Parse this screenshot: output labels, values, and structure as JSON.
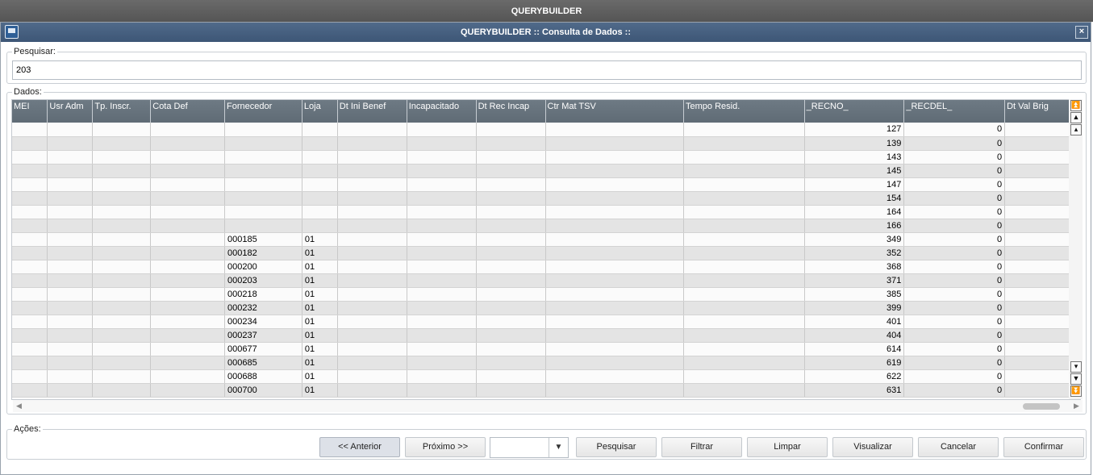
{
  "window": {
    "title": "QUERYBUILDER",
    "dialog_title": "QUERYBUILDER :: Consulta de Dados ::",
    "close_label": "×"
  },
  "search": {
    "legend": "Pesquisar:",
    "value": "203"
  },
  "data_group": {
    "legend": "Dados:",
    "columns": [
      "MEI",
      "Usr Adm",
      "Tp. Inscr.",
      "Cota Def",
      "Fornecedor",
      "Loja",
      "Dt Ini Benef",
      "Incapacitado",
      "Dt Rec Incap",
      "Ctr Mat TSV",
      "Tempo Resid.",
      "_RECNO_",
      "_RECDEL_",
      "Dt Val Brig"
    ],
    "rows": [
      {
        "fornecedor": "",
        "loja": "",
        "recno": "127",
        "recdel": "0"
      },
      {
        "fornecedor": "",
        "loja": "",
        "recno": "139",
        "recdel": "0"
      },
      {
        "fornecedor": "",
        "loja": "",
        "recno": "143",
        "recdel": "0"
      },
      {
        "fornecedor": "",
        "loja": "",
        "recno": "145",
        "recdel": "0"
      },
      {
        "fornecedor": "",
        "loja": "",
        "recno": "147",
        "recdel": "0"
      },
      {
        "fornecedor": "",
        "loja": "",
        "recno": "154",
        "recdel": "0"
      },
      {
        "fornecedor": "",
        "loja": "",
        "recno": "164",
        "recdel": "0"
      },
      {
        "fornecedor": "",
        "loja": "",
        "recno": "166",
        "recdel": "0"
      },
      {
        "fornecedor": "000185",
        "loja": "01",
        "recno": "349",
        "recdel": "0"
      },
      {
        "fornecedor": "000182",
        "loja": "01",
        "recno": "352",
        "recdel": "0"
      },
      {
        "fornecedor": "000200",
        "loja": "01",
        "recno": "368",
        "recdel": "0"
      },
      {
        "fornecedor": "000203",
        "loja": "01",
        "recno": "371",
        "recdel": "0"
      },
      {
        "fornecedor": "000218",
        "loja": "01",
        "recno": "385",
        "recdel": "0"
      },
      {
        "fornecedor": "000232",
        "loja": "01",
        "recno": "399",
        "recdel": "0"
      },
      {
        "fornecedor": "000234",
        "loja": "01",
        "recno": "401",
        "recdel": "0"
      },
      {
        "fornecedor": "000237",
        "loja": "01",
        "recno": "404",
        "recdel": "0"
      },
      {
        "fornecedor": "000677",
        "loja": "01",
        "recno": "614",
        "recdel": "0"
      },
      {
        "fornecedor": "000685",
        "loja": "01",
        "recno": "619",
        "recdel": "0"
      },
      {
        "fornecedor": "000688",
        "loja": "01",
        "recno": "622",
        "recdel": "0"
      },
      {
        "fornecedor": "000700",
        "loja": "01",
        "recno": "631",
        "recdel": "0"
      }
    ],
    "scroll": {
      "top_icon": "scroll-top-icon",
      "page_up_icon": "page-up-icon",
      "up_icon": "scroll-up-icon",
      "down_icon": "scroll-down-icon",
      "page_down_icon": "page-down-icon",
      "bottom_icon": "scroll-bottom-icon"
    }
  },
  "actions": {
    "legend": "Ações:",
    "anterior": "<< Anterior",
    "proximo": "Próximo >>",
    "combo_value": "",
    "pesquisar": "Pesquisar",
    "filtrar": "Filtrar",
    "limpar": "Limpar",
    "visualizar": "Visualizar",
    "cancelar": "Cancelar",
    "confirmar": "Confirmar"
  }
}
